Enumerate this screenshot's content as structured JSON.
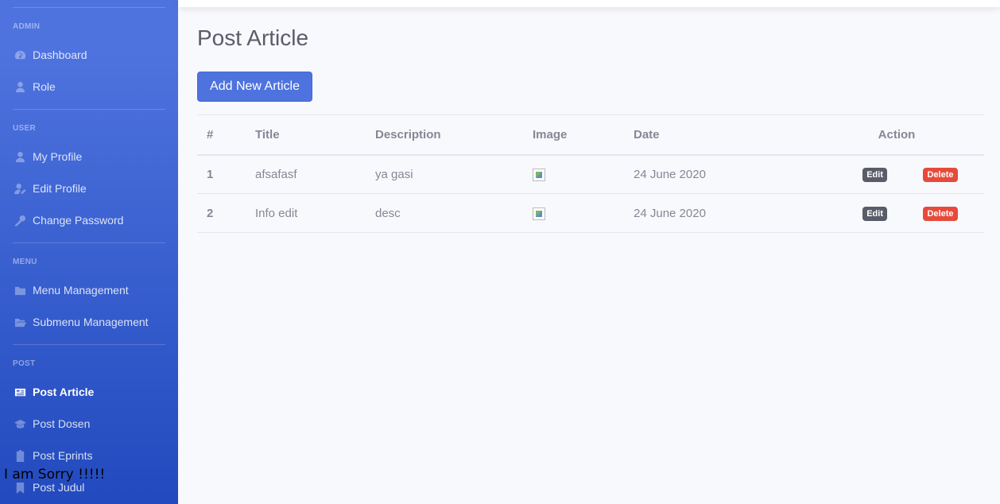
{
  "sidebar": {
    "sections": [
      {
        "heading": "ADMIN",
        "items": [
          {
            "label": "Dashboard",
            "icon": "tachometer-icon"
          },
          {
            "label": "Role",
            "icon": "user-tie-icon"
          }
        ]
      },
      {
        "heading": "USER",
        "items": [
          {
            "label": "My Profile",
            "icon": "user-icon"
          },
          {
            "label": "Edit Profile",
            "icon": "user-edit-icon"
          },
          {
            "label": "Change Password",
            "icon": "key-icon"
          }
        ]
      },
      {
        "heading": "MENU",
        "items": [
          {
            "label": "Menu Management",
            "icon": "folder-icon"
          },
          {
            "label": "Submenu Management",
            "icon": "folder-open-icon"
          }
        ]
      },
      {
        "heading": "POST",
        "items": [
          {
            "label": "Post Article",
            "icon": "newspaper-icon",
            "active": true
          },
          {
            "label": "Post Dosen",
            "icon": "graduation-cap-icon"
          },
          {
            "label": "Post Eprints",
            "icon": "clipboard-icon"
          },
          {
            "label": "Post Judul",
            "icon": "bookmark-icon"
          }
        ]
      }
    ]
  },
  "main": {
    "title": "Post Article",
    "add_button": "Add New Article",
    "table": {
      "headers": [
        "#",
        "Title",
        "Description",
        "Image",
        "Date",
        "Action"
      ],
      "rows": [
        {
          "num": "1",
          "title": "afsafasf",
          "description": "ya gasi",
          "date": "24 June 2020",
          "edit": "Edit",
          "delete": "Delete"
        },
        {
          "num": "2",
          "title": "Info edit",
          "description": "desc",
          "date": "24 June 2020",
          "edit": "Edit",
          "delete": "Delete"
        }
      ]
    }
  },
  "overlay_text": "I am Sorry !!!!!",
  "colors": {
    "primary": "#4e73df",
    "danger": "#e74a3b",
    "dark": "#5a5c69",
    "text": "#858796"
  }
}
